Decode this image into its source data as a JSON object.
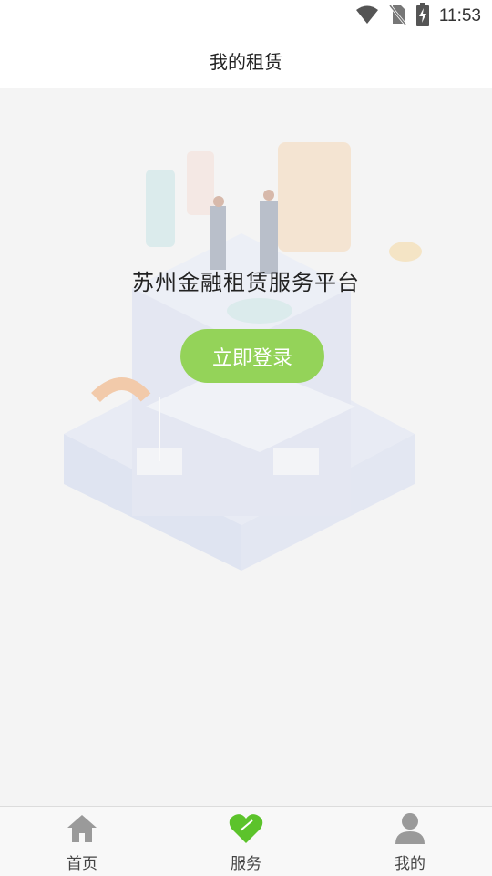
{
  "status_bar": {
    "time": "11:53",
    "icons": [
      "wifi-icon",
      "no-sim-icon",
      "battery-charging-icon"
    ]
  },
  "header": {
    "title": "我的租赁"
  },
  "main": {
    "platform_title": "苏州金融租赁服务平台",
    "login_button_label": "立即登录",
    "login_button_color": "#94d359"
  },
  "tabs": [
    {
      "label": "首页",
      "icon": "home-icon",
      "active": false,
      "color": "#9a9a9a"
    },
    {
      "label": "服务",
      "icon": "heart-icon",
      "active": true,
      "color": "#5cc32b"
    },
    {
      "label": "我的",
      "icon": "person-icon",
      "active": false,
      "color": "#9a9a9a"
    }
  ]
}
